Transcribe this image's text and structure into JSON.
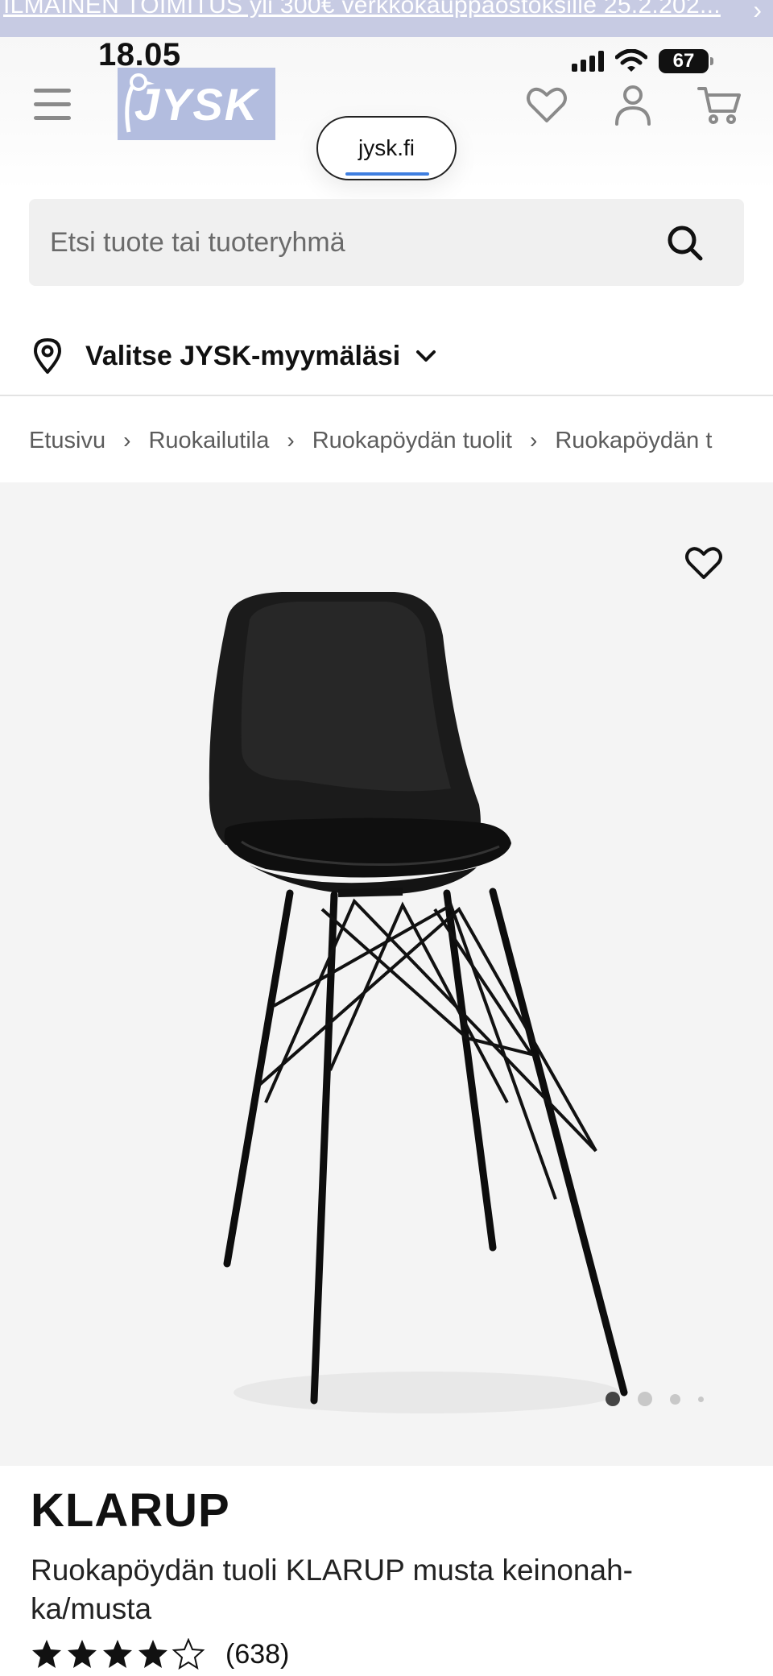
{
  "promo": {
    "text": "ILMAINEN TOIMITUS yli 300€ verkkokauppaostoksille 25.2.202...",
    "arrow": "›"
  },
  "status": {
    "time": "18.05",
    "battery": "67"
  },
  "header": {
    "logo_text": "JYSK",
    "url": "jysk.fi",
    "icons": [
      "menu-icon",
      "heart-icon",
      "user-icon",
      "cart-icon"
    ]
  },
  "search": {
    "placeholder": "Etsi tuote tai tuoteryhmä"
  },
  "store": {
    "label": "Valitse JYSK-myymäläsi"
  },
  "breadcrumb": {
    "items": [
      "Etusivu",
      "Ruokailutila",
      "Ruokapöydän tuolit",
      "Ruokapöydän t"
    ],
    "separator": "›"
  },
  "gallery": {
    "image_count": 4,
    "active_index": 0
  },
  "product": {
    "name": "KLARUP",
    "description": "Ruokapöydän tuoli KLARUP musta keinonah-ka/musta",
    "rating": 4.5,
    "rating_max": 5,
    "review_count": "(638)"
  },
  "colors": {
    "brand": "#b3bddf",
    "promo_bg": "#c7cbe3",
    "text": "#141414",
    "gallery_bg": "#f4f4f4"
  }
}
